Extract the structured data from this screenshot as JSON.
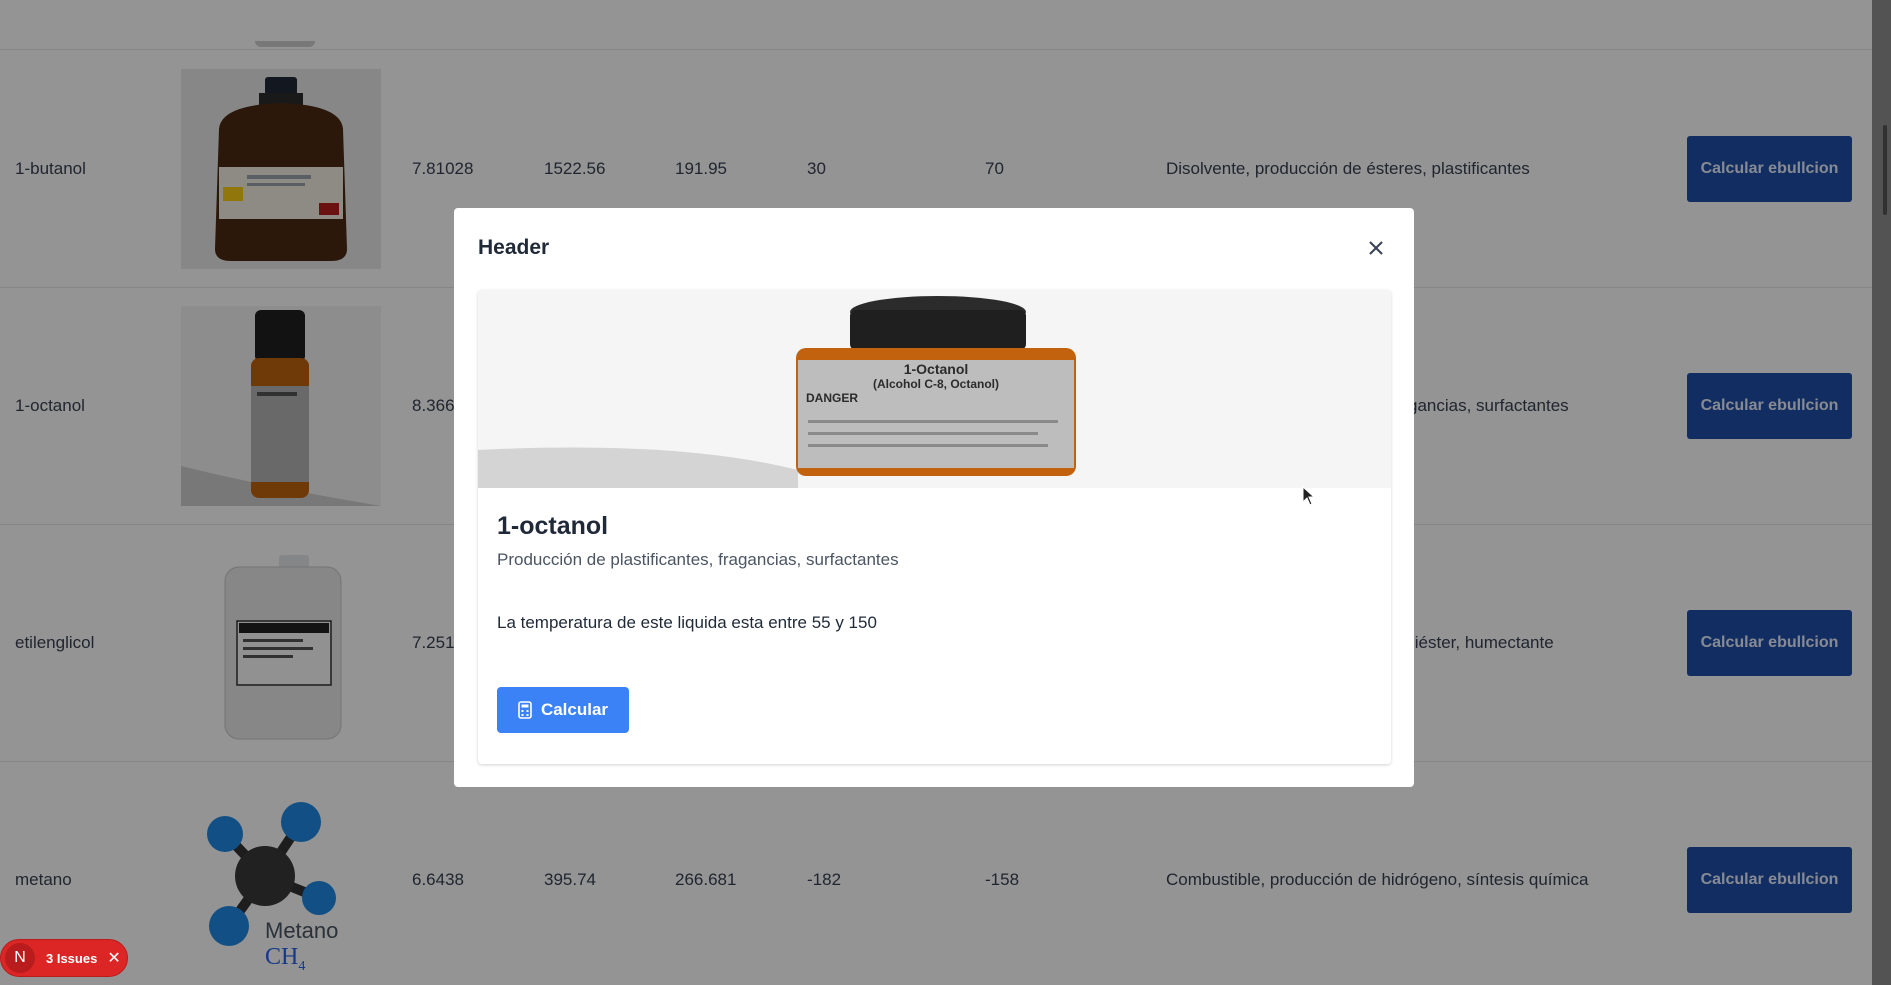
{
  "table": {
    "rows": [
      {
        "name": "1-butanol",
        "v1": "7.81028",
        "v2": "1522.56",
        "v3": "191.95",
        "v4": "30",
        "v5": "70",
        "uses": "Disolvente, producción de ésteres, plastificantes",
        "button": "Calcular ebullcion",
        "image": "amber-bottle-icon"
      },
      {
        "name": "1-octanol",
        "v1": "8.366",
        "v2": "",
        "v3": "",
        "v4": "",
        "v5": "",
        "uses": "gancias, surfactantes",
        "button": "Calcular ebullcion",
        "image": "octanol-bottle-icon"
      },
      {
        "name": "etilenglicol",
        "v1": "7.251",
        "v2": "",
        "v3": "",
        "v4": "",
        "v5": "",
        "uses": "liéster, humectante",
        "button": "Calcular ebullcion",
        "image": "canister-icon"
      },
      {
        "name": "metano",
        "v1": "6.6438",
        "v2": "395.74",
        "v3": "266.681",
        "v4": "-182",
        "v5": "-158",
        "uses": "Combustible, producción de hidrógeno, síntesis química",
        "button": "Calcular ebullcion",
        "image": "methane-molecule-icon",
        "molecule_label": "Metano",
        "formula": "CH",
        "formula_sub": "4"
      }
    ]
  },
  "modal": {
    "title": "Header",
    "card": {
      "title": "1-octanol",
      "subtitle": "Producción de plastificantes, fragancias, surfactantes",
      "text": "La temperatura de este liquida esta entre 55 y 150",
      "button": "Calcular",
      "bottle_label_1": "1-Octanol",
      "bottle_label_2": "(Alcohol C-8, Octanol)",
      "bottle_warning": "DANGER"
    }
  },
  "issues_badge": {
    "logo": "N",
    "label": "3 Issues"
  },
  "colors": {
    "primary_button": "#3b82f6",
    "row_button": "#1f4fa8",
    "issues": "#dc2626"
  }
}
